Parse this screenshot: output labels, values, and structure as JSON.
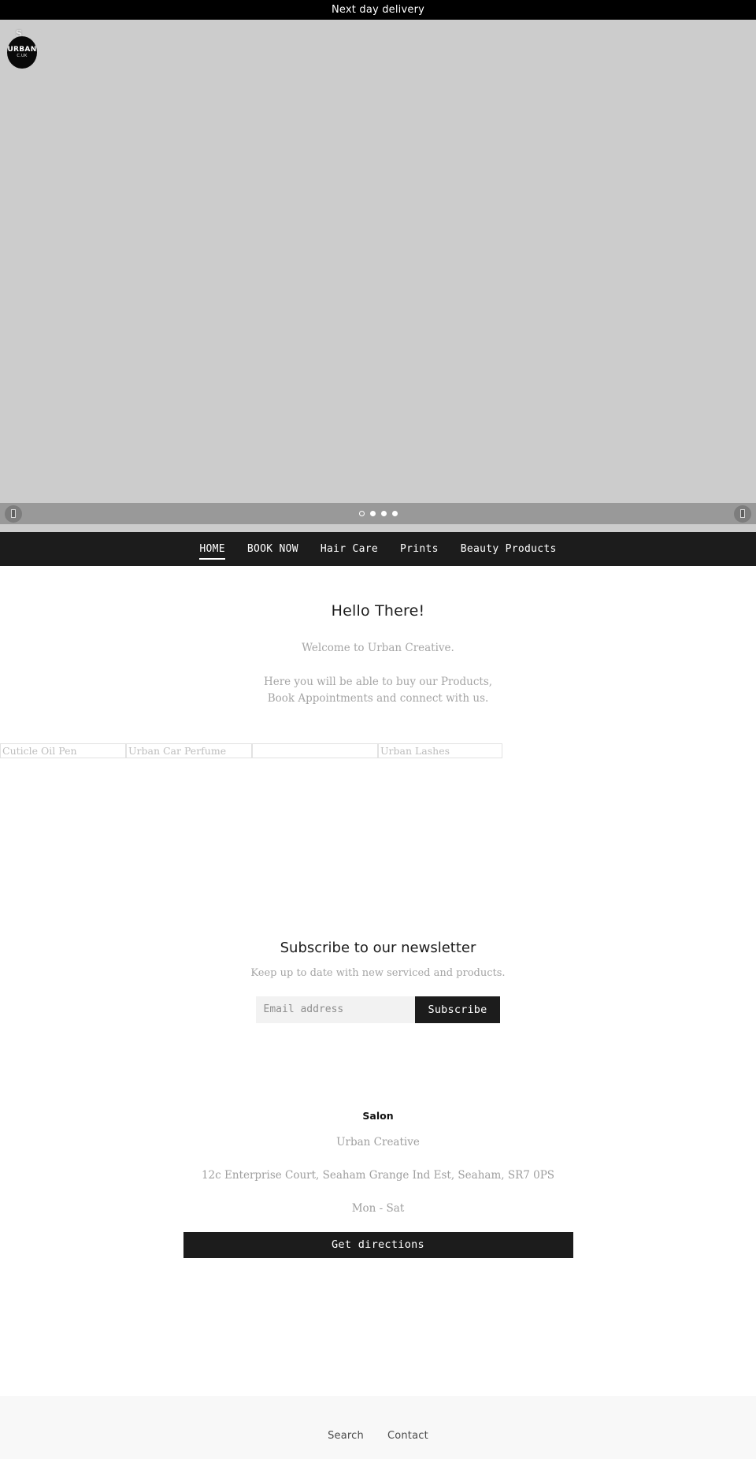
{
  "announcement": {
    "text": "Next day delivery"
  },
  "hero": {
    "logo": {
      "mark": "S",
      "main": "URBAN",
      "sub": "C.UK"
    },
    "slideshow": {
      "prev_label": "‹",
      "next_label": "›",
      "prev_icon": "previous-slide-icon",
      "next_icon": "next-slide-icon",
      "slide_count": 4,
      "active_slide": 1,
      "background_color": "#cccccc",
      "control_bar_color": "#999999"
    }
  },
  "nav": {
    "active": "HOME",
    "items": [
      {
        "label": "HOME"
      },
      {
        "label": "BOOK NOW"
      },
      {
        "label": "Hair Care"
      },
      {
        "label": "Prints"
      },
      {
        "label": "Beauty Products"
      }
    ]
  },
  "intro": {
    "heading": "Hello There!",
    "line1": "Welcome to Urban Creative.",
    "line2": "Here you will be able to buy our Products, Book Appointments and connect with us."
  },
  "products": {
    "items": [
      {
        "title": "Cuticle Oil Pen"
      },
      {
        "title": "Urban Car Perfume"
      },
      {
        "title": ""
      },
      {
        "title": "Urban Lashes"
      }
    ]
  },
  "newsletter": {
    "heading": "Subscribe to our newsletter",
    "subheading": "Keep up to date with new serviced and products.",
    "email_placeholder": "Email address",
    "email_value": "",
    "submit_label": "Subscribe"
  },
  "salon": {
    "heading": "Salon",
    "name": "Urban Creative",
    "address": "12c Enterprise Court, Seaham Grange Ind Est, Seaham, SR7 0PS",
    "hours": "Mon - Sat",
    "directions_label": "Get directions"
  },
  "footer": {
    "links": [
      {
        "label": "Search"
      },
      {
        "label": "Contact"
      }
    ]
  },
  "colors": {
    "accent_dark": "#1c1c1c",
    "announce_bg": "#000000",
    "hero_bg": "#cccccc",
    "footer_bg": "#f8f8f8",
    "muted_text": "#a5a5a5"
  }
}
